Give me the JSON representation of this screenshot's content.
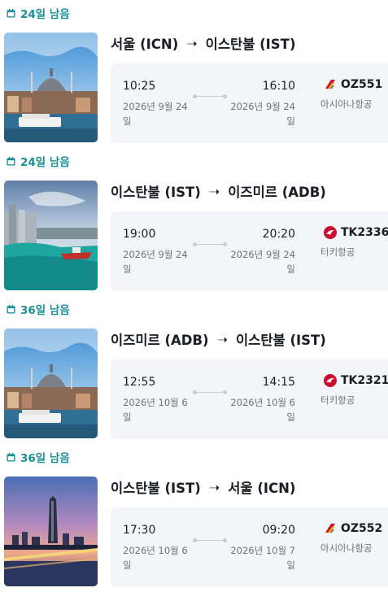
{
  "colors": {
    "accent": "#1a8f9c",
    "card_bg": "#f4f5f8",
    "asiana": "#c8102e",
    "turkish": "#c8102e"
  },
  "trips": [
    {
      "days_left": "24일 남음",
      "route": {
        "from": "서울 (ICN)",
        "to": "이스탄불 (IST)",
        "arrow": "➝"
      },
      "photo": "istanbul-mosque-waterfront",
      "dep_time": "10:25",
      "dep_date": "2026년 9월 24일",
      "arr_time": "16:10",
      "arr_date": "2026년 9월 24일",
      "flight": "OZ551",
      "airline": "아시아나항공",
      "airline_icon": "asiana-logo-icon"
    },
    {
      "days_left": "24일 남음",
      "route": {
        "from": "이스탄불 (IST)",
        "to": "이즈미르 (ADB)",
        "arrow": "➝"
      },
      "photo": "izmir-coast",
      "dep_time": "19:00",
      "dep_date": "2026년 9월 24일",
      "arr_time": "20:20",
      "arr_date": "2026년 9월 24일",
      "flight": "TK2336",
      "airline": "터키항공",
      "airline_icon": "turkish-airlines-logo-icon"
    },
    {
      "days_left": "36일 남음",
      "route": {
        "from": "이즈미르 (ADB)",
        "to": "이스탄불 (IST)",
        "arrow": "➝"
      },
      "photo": "istanbul-mosque-waterfront",
      "dep_time": "12:55",
      "dep_date": "2026년 10월 6일",
      "arr_time": "14:15",
      "arr_date": "2026년 10월 6일",
      "flight": "TK2321",
      "airline": "터키항공",
      "airline_icon": "turkish-airlines-logo-icon"
    },
    {
      "days_left": "36일 남음",
      "route": {
        "from": "이스탄불 (IST)",
        "to": "서울 (ICN)",
        "arrow": "➝"
      },
      "photo": "seoul-night-skyline",
      "dep_time": "17:30",
      "dep_date": "2026년 10월 6일",
      "arr_time": "09:20",
      "arr_date": "2026년 10월 7일",
      "flight": "OZ552",
      "airline": "아시아나항공",
      "airline_icon": "asiana-logo-icon"
    }
  ]
}
